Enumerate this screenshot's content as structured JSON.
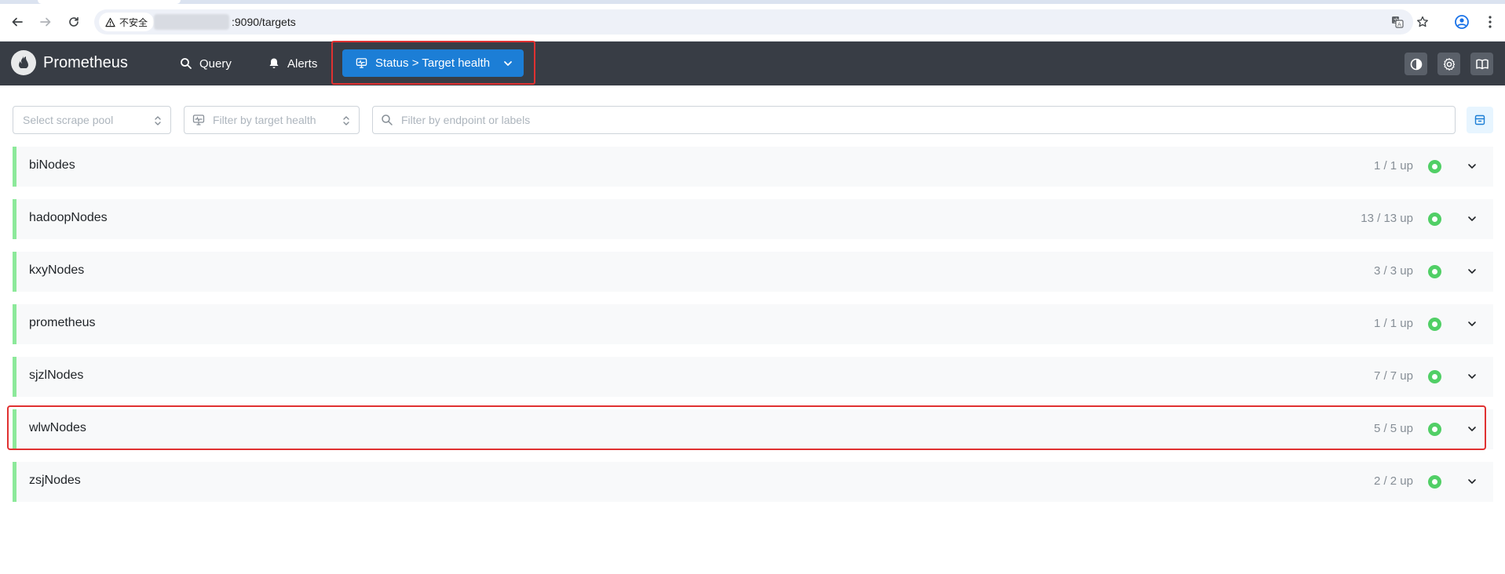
{
  "browser": {
    "security_label": "不安全",
    "url": ":9090/targets"
  },
  "header": {
    "brand": "Prometheus",
    "nav": {
      "query": "Query",
      "alerts": "Alerts",
      "status": "Status > Target health"
    }
  },
  "filters": {
    "scrape_pool_placeholder": "Select scrape pool",
    "health_placeholder": "Filter by target health",
    "search_placeholder": "Filter by endpoint or labels"
  },
  "pools": [
    {
      "name": "biNodes",
      "count": "1 / 1 up"
    },
    {
      "name": "hadoopNodes",
      "count": "13 / 13 up"
    },
    {
      "name": "kxyNodes",
      "count": "3 / 3 up"
    },
    {
      "name": "prometheus",
      "count": "1 / 1 up"
    },
    {
      "name": "sjzlNodes",
      "count": "7 / 7 up"
    },
    {
      "name": "wlwNodes",
      "count": "5 / 5 up"
    },
    {
      "name": "zsjNodes",
      "count": "2 / 2 up"
    }
  ],
  "colors": {
    "header_bg": "#383d45",
    "accent": "#1c7ed6",
    "healthy": "#51cf66",
    "highlight": "#e03131"
  }
}
